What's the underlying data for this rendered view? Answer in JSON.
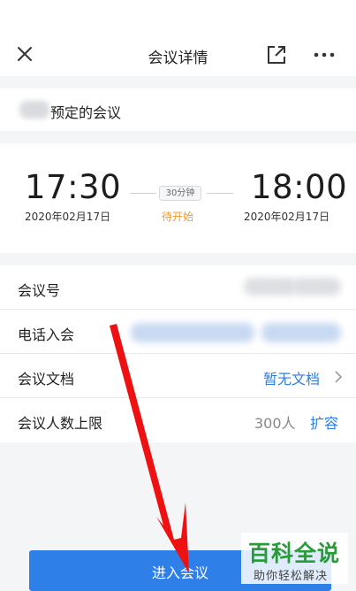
{
  "header": {
    "title": "会议详情",
    "close_icon": "close-icon",
    "share_icon": "share-icon",
    "more_icon": "more-icon"
  },
  "organizer": {
    "label": "预定的会议"
  },
  "schedule": {
    "start_time": "17:30",
    "start_date": "2020年02月17日",
    "end_time": "18:00",
    "end_date": "2020年02月17日",
    "duration": "30分钟",
    "status": "待开始",
    "status_color": "#f19a2a"
  },
  "details": {
    "meeting_id_label": "会议号",
    "dial_in_label": "电话入会",
    "docs_label": "会议文档",
    "docs_value": "暂无文档",
    "capacity_label": "会议人数上限",
    "capacity_value": "300人",
    "expand_label": "扩容",
    "link_color": "#2f7fe0"
  },
  "actions": {
    "join_label": "进入会议",
    "join_color": "#2f7fe8"
  },
  "watermark": {
    "brand": "百科全说",
    "slogan": "助你轻松解决"
  }
}
